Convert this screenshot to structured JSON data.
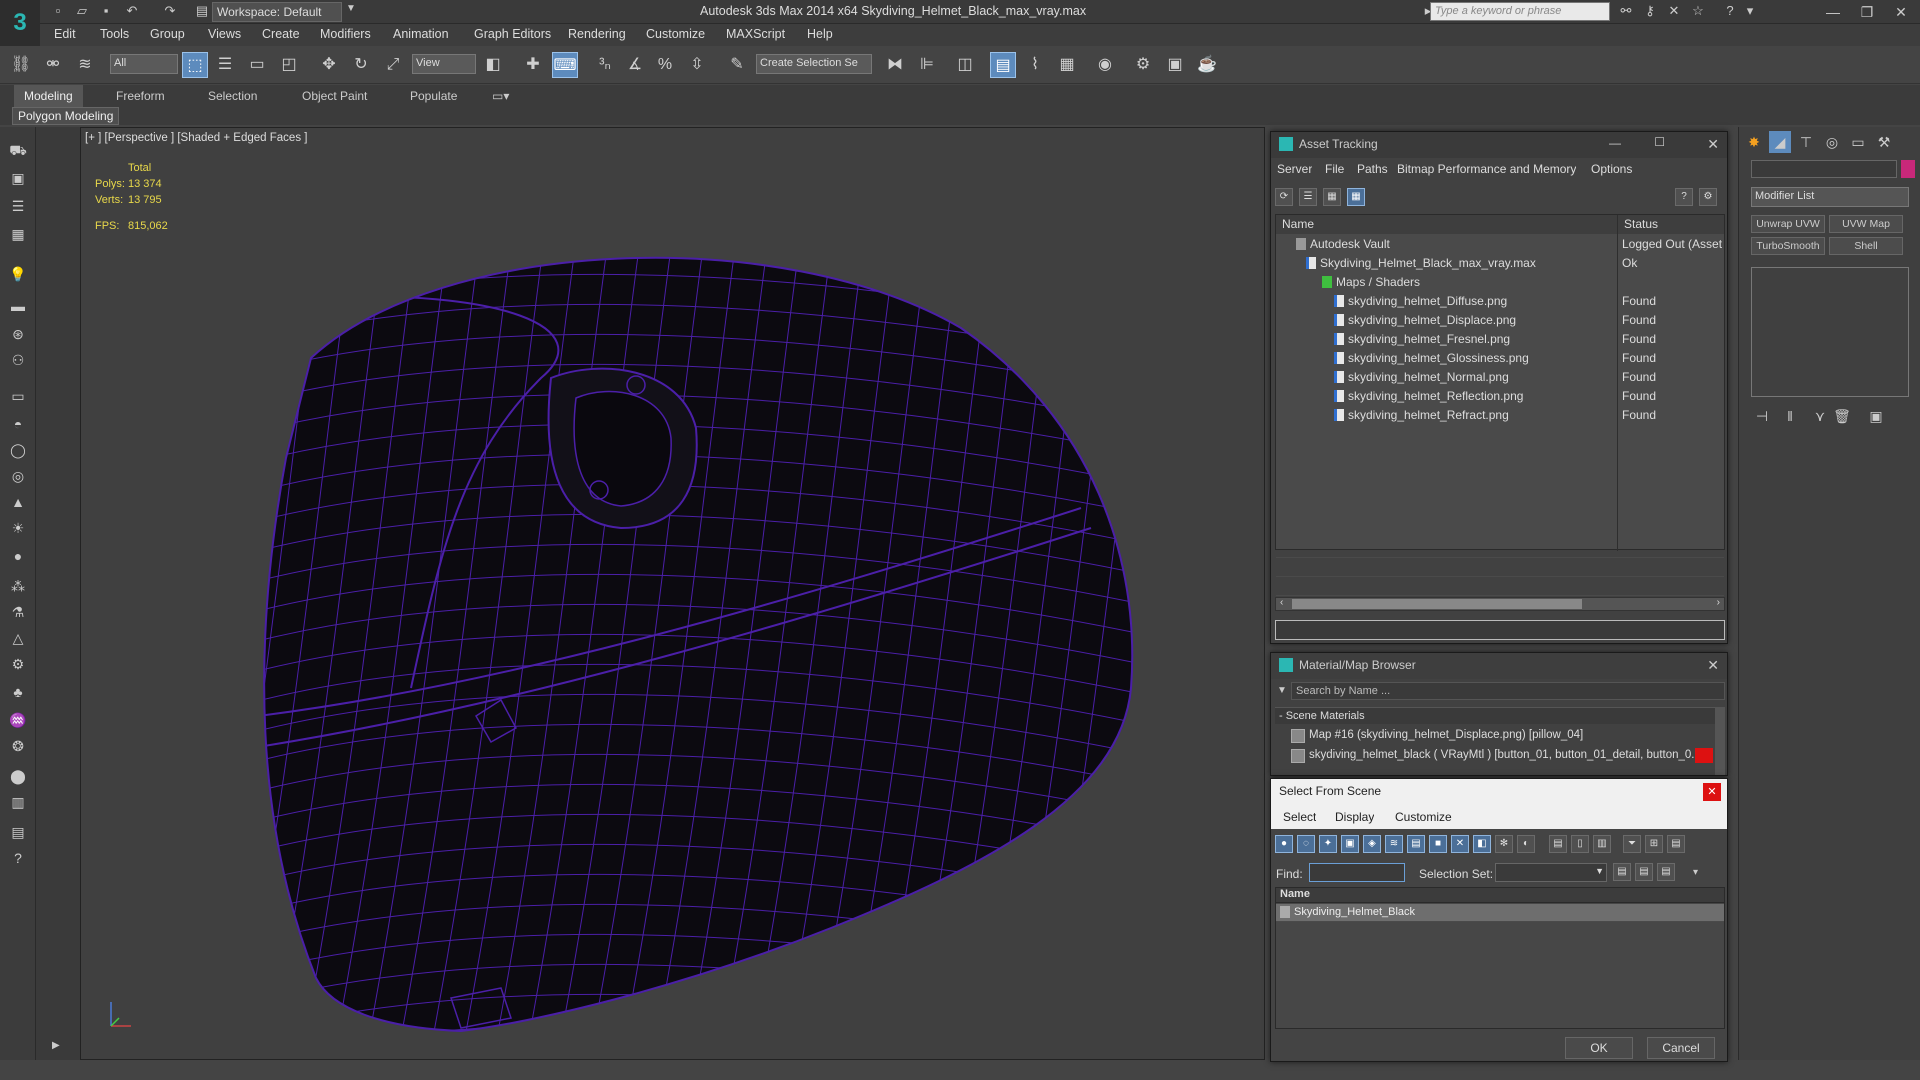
{
  "titlebar": {
    "workspace": "Workspace: Default",
    "title": "Autodesk 3ds Max  2014 x64     Skydiving_Helmet_Black_max_vray.max",
    "search_placeholder": "Type a keyword or phrase"
  },
  "menu": [
    "Edit",
    "Tools",
    "Group",
    "Views",
    "Create",
    "Modifiers",
    "Animation",
    "Graph Editors",
    "Rendering",
    "Customize",
    "MAXScript",
    "Help"
  ],
  "toolbar": {
    "selection_filter": "All",
    "reference_coord": "View",
    "named_selection": "Create Selection Se"
  },
  "ribbon": {
    "tabs": [
      "Modeling",
      "Freeform",
      "Selection",
      "Object Paint",
      "Populate"
    ],
    "panel_label": "Polygon Modeling"
  },
  "viewport": {
    "label": "[+ ] [Perspective ] [Shaded + Edged Faces ]",
    "stats": {
      "total_label": "Total",
      "polys_label": "Polys:",
      "polys_value": "13 374",
      "verts_label": "Verts:",
      "verts_value": "13 795",
      "fps_label": "FPS:",
      "fps_value": "815,062"
    },
    "wire_color": "#4b1fa8",
    "background": "#404040"
  },
  "command_panel": {
    "modifier_list": "Modifier List",
    "buttons": [
      "Unwrap UVW",
      "UVW Map",
      "TurboSmooth",
      "Shell"
    ]
  },
  "asset_tracking": {
    "title": "Asset Tracking",
    "menu": [
      "Server",
      "File",
      "Paths",
      "Bitmap Performance and Memory",
      "Options"
    ],
    "columns": [
      "Name",
      "Status"
    ],
    "rows": [
      {
        "name": "Autodesk Vault",
        "status": "Logged Out (Asset T"
      },
      {
        "name": "Skydiving_Helmet_Black_max_vray.max",
        "status": "Ok"
      },
      {
        "name": "Maps / Shaders",
        "status": ""
      },
      {
        "name": "skydiving_helmet_Diffuse.png",
        "status": "Found"
      },
      {
        "name": "skydiving_helmet_Displace.png",
        "status": "Found"
      },
      {
        "name": "skydiving_helmet_Fresnel.png",
        "status": "Found"
      },
      {
        "name": "skydiving_helmet_Glossiness.png",
        "status": "Found"
      },
      {
        "name": "skydiving_helmet_Normal.png",
        "status": "Found"
      },
      {
        "name": "skydiving_helmet_Reflection.png",
        "status": "Found"
      },
      {
        "name": "skydiving_helmet_Refract.png",
        "status": "Found"
      }
    ]
  },
  "material_browser": {
    "title": "Material/Map Browser",
    "search_placeholder": "Search by Name ...",
    "group": "- Scene Materials",
    "items": [
      "Map #16 (skydiving_helmet_Displace.png) [pillow_04]",
      "skydiving_helmet_black  ( VRayMtl ) [button_01, button_01_detail, button_0..."
    ]
  },
  "select_from_scene": {
    "title": "Select From Scene",
    "menu": [
      "Select",
      "Display",
      "Customize"
    ],
    "find_label": "Find:",
    "selection_set_label": "Selection Set:",
    "column": "Name",
    "objects": [
      "Skydiving_Helmet_Black"
    ],
    "ok": "OK",
    "cancel": "Cancel"
  }
}
